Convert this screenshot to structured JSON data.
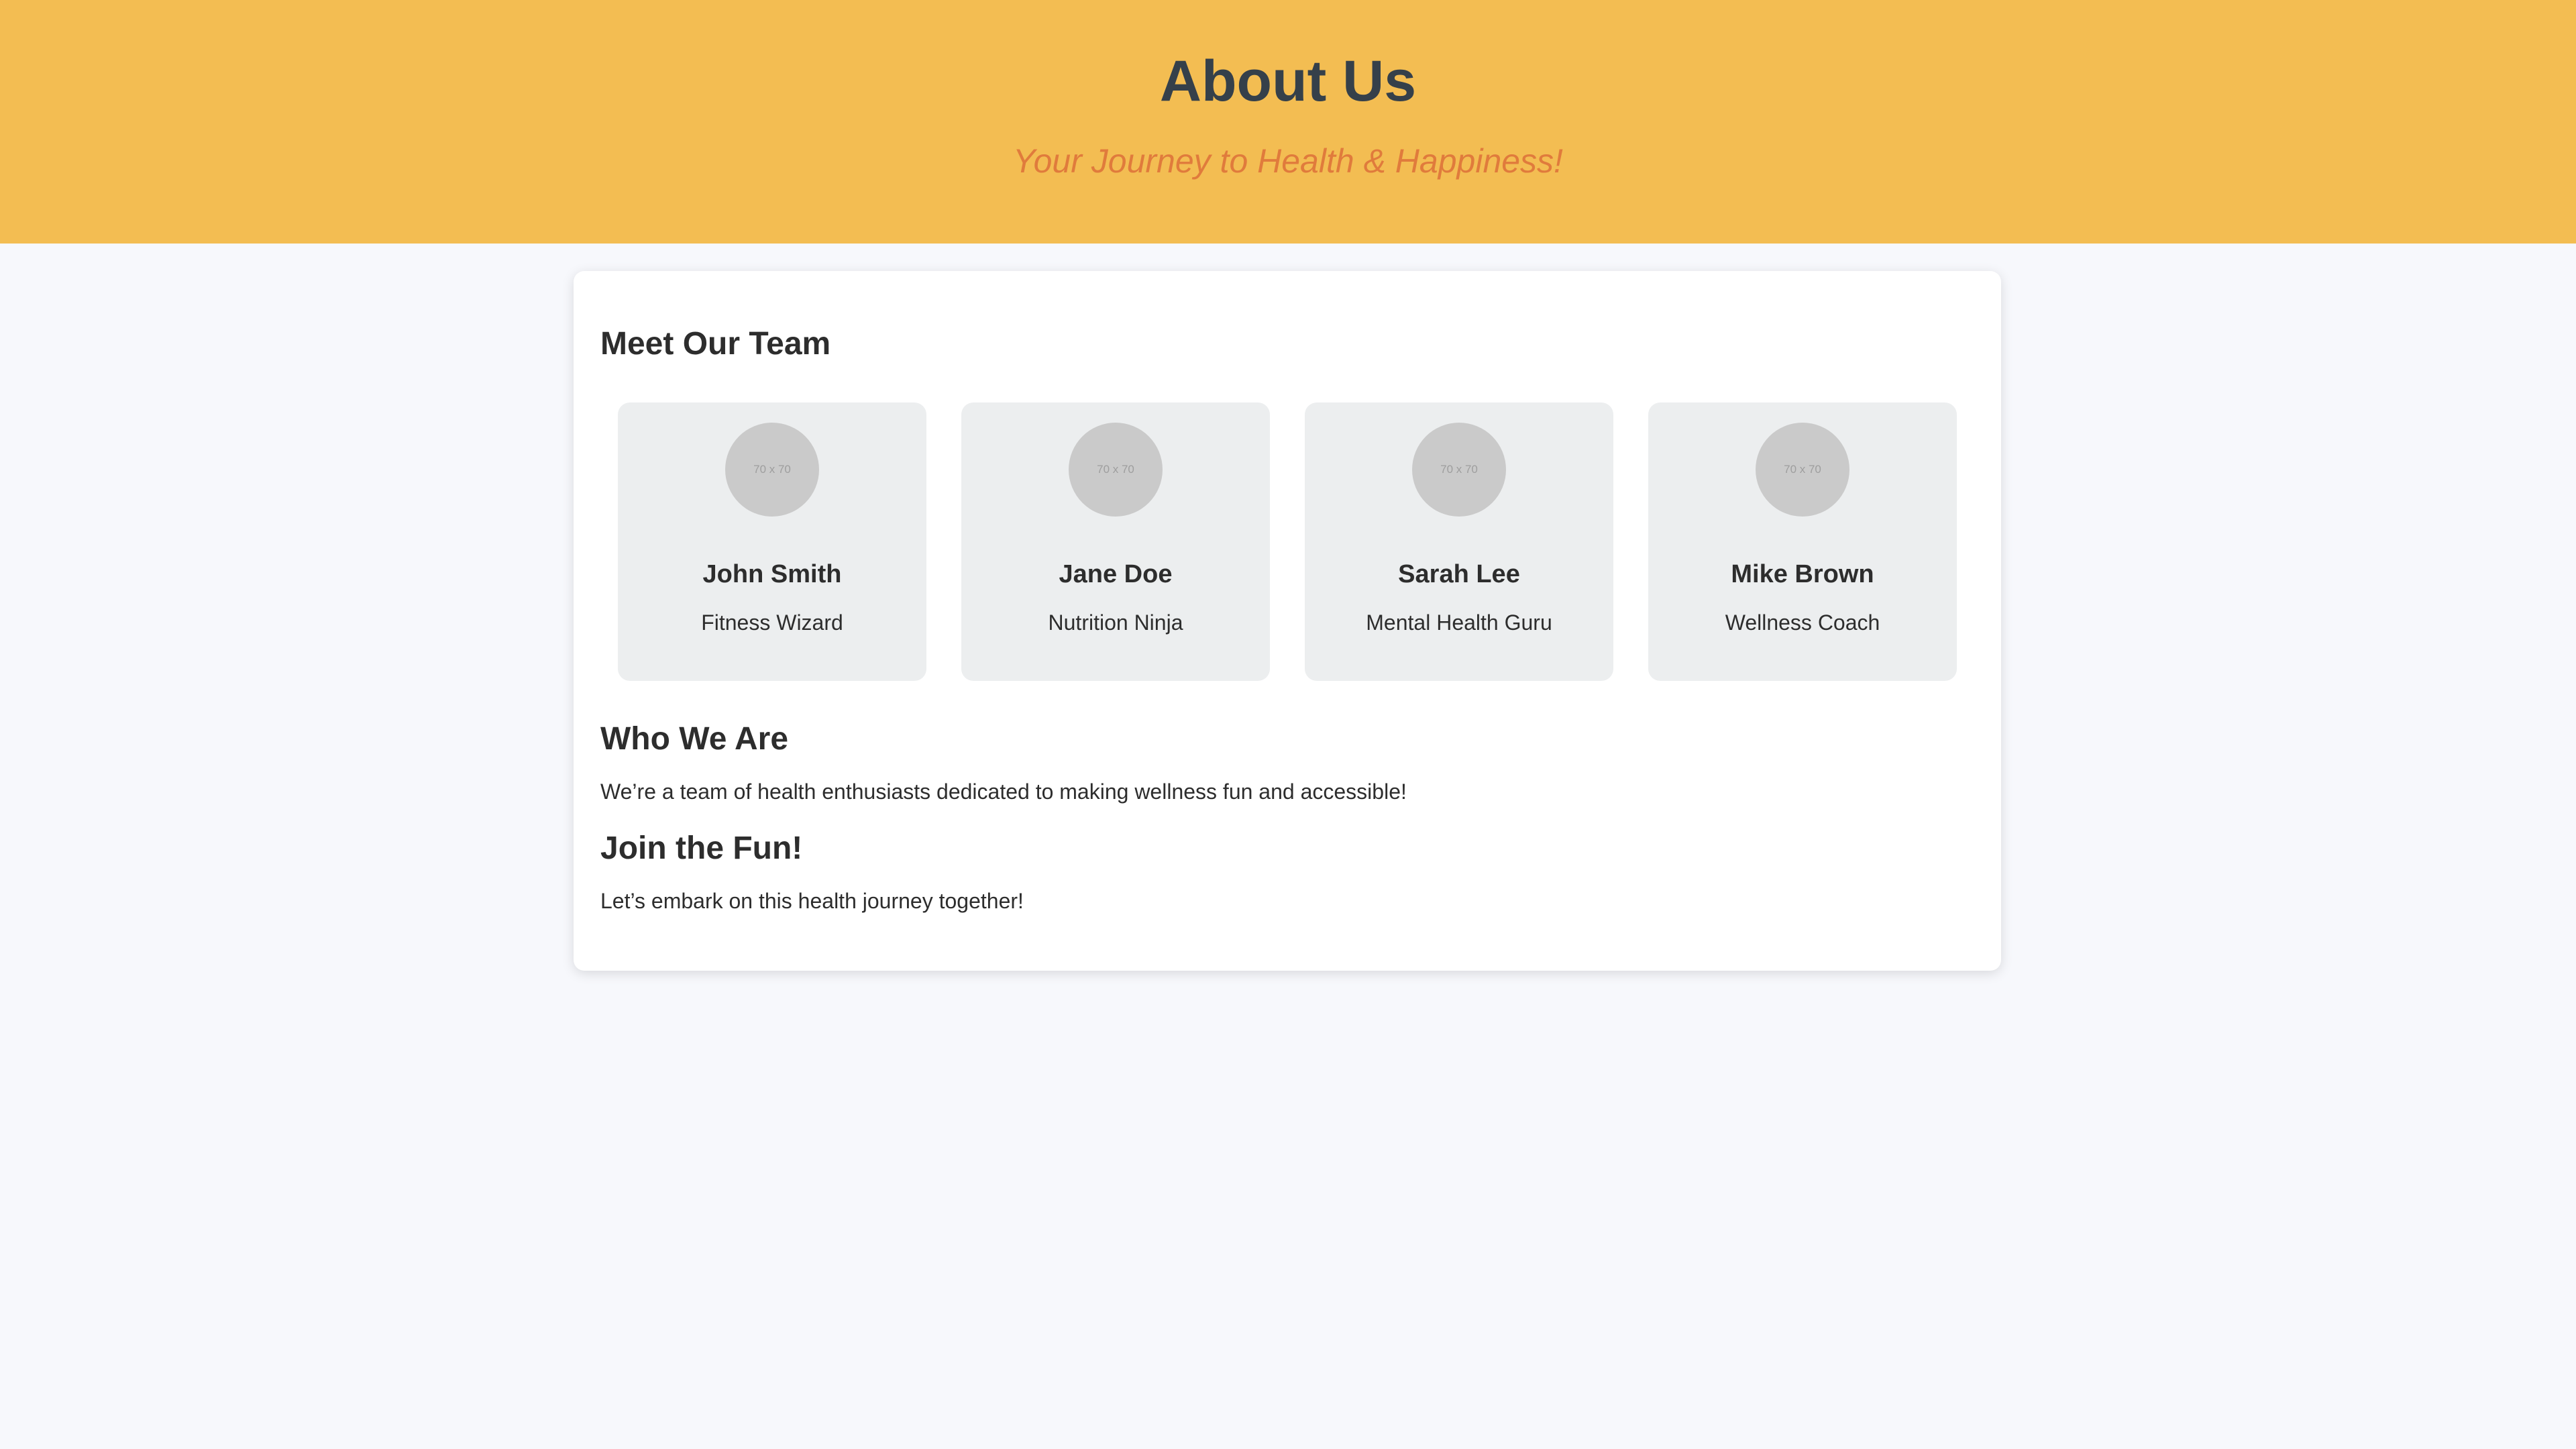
{
  "header": {
    "title": "About Us",
    "tagline": "Your Journey to Health & Happiness!"
  },
  "colors": {
    "header_bg": "#f3bd52",
    "title_color": "#35404a",
    "tagline_color": "#e07b3c",
    "page_bg": "#f7f8fc",
    "member_card_bg": "#eceeef",
    "avatar_bg": "#cacaca"
  },
  "team": {
    "heading": "Meet Our Team",
    "members": [
      {
        "avatar_label": "70 x 70",
        "name": "John Smith",
        "role": "Fitness Wizard"
      },
      {
        "avatar_label": "70 x 70",
        "name": "Jane Doe",
        "role": "Nutrition Ninja"
      },
      {
        "avatar_label": "70 x 70",
        "name": "Sarah Lee",
        "role": "Mental Health Guru"
      },
      {
        "avatar_label": "70 x 70",
        "name": "Mike Brown",
        "role": "Wellness Coach"
      }
    ]
  },
  "who_we_are": {
    "heading": "Who We Are",
    "text": "We’re a team of health enthusiasts dedicated to making wellness fun and accessible!"
  },
  "join": {
    "heading": "Join the Fun!",
    "text": "Let’s embark on this health journey together!"
  }
}
